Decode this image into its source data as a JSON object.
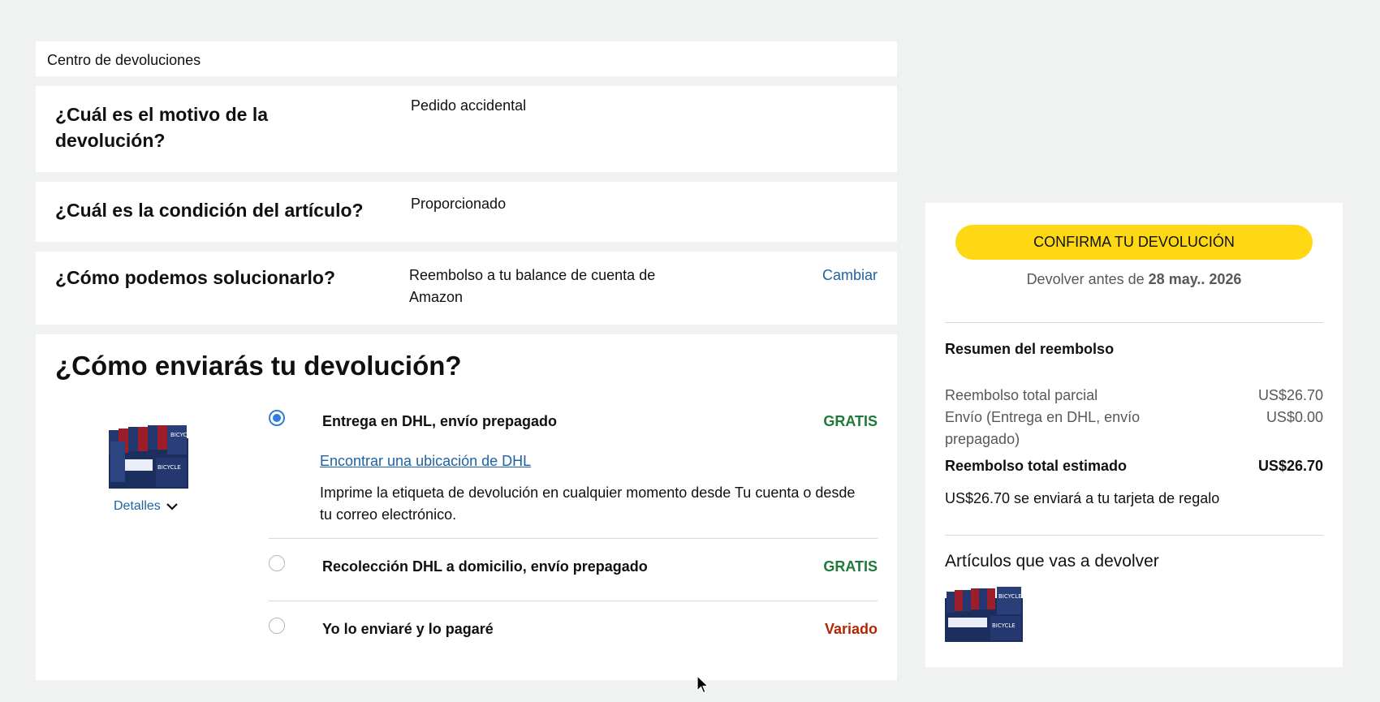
{
  "breadcrumb": "Centro de devoluciones",
  "questions": [
    {
      "title": "¿Cuál es el motivo de la devolución?",
      "answer": "Pedido accidental"
    },
    {
      "title": "¿Cuál es la condición del artículo?",
      "answer": "Proporcionado"
    },
    {
      "title": "¿Cómo podemos solucionarlo?",
      "answer": "Reembolso a tu balance de cuenta de Amazon",
      "action": "Cambiar"
    }
  ],
  "shipping": {
    "title": "¿Cómo enviarás tu devolución?",
    "details_label": "Detalles",
    "product_image": "bicycle-playing-cards-box-image",
    "options": [
      {
        "label": "Entrega en DHL, envío prepagado",
        "price": "GRATIS",
        "selected": true,
        "link": "Encontrar una ubicación de DHL",
        "note": "Imprime la etiqueta de devolución en cualquier momento desde Tu cuenta o desde tu correo electrónico."
      },
      {
        "label": "Recolección DHL a domicilio, envío prepagado",
        "price": "GRATIS",
        "selected": false
      },
      {
        "label": "Yo lo enviaré y lo pagaré",
        "price": "Variado",
        "selected": false
      }
    ]
  },
  "summary": {
    "confirm_label": "CONFIRMA TU DEVOLUCIÓN",
    "return_by_prefix": "Devolver antes de",
    "return_by_date": "28 may.. 2026",
    "refund_title": "Resumen del reembolso",
    "rows": [
      {
        "label": "Reembolso total parcial",
        "amount": "US$26.70"
      },
      {
        "label": "Envío (Entrega en DHL, envío prepagado)",
        "amount": "US$0.00"
      },
      {
        "label": "Reembolso total estimado",
        "amount": "US$26.70"
      }
    ],
    "gift_note": "US$26.70 se enviará a tu tarjeta de regalo",
    "items_title": "Artículos que vas a devolver"
  },
  "colors": {
    "accent_button": "#ffd814",
    "link": "#2162a1",
    "free": "#1f7a3a",
    "variable": "#b12704",
    "radio_selected": "#2f7dd8"
  }
}
